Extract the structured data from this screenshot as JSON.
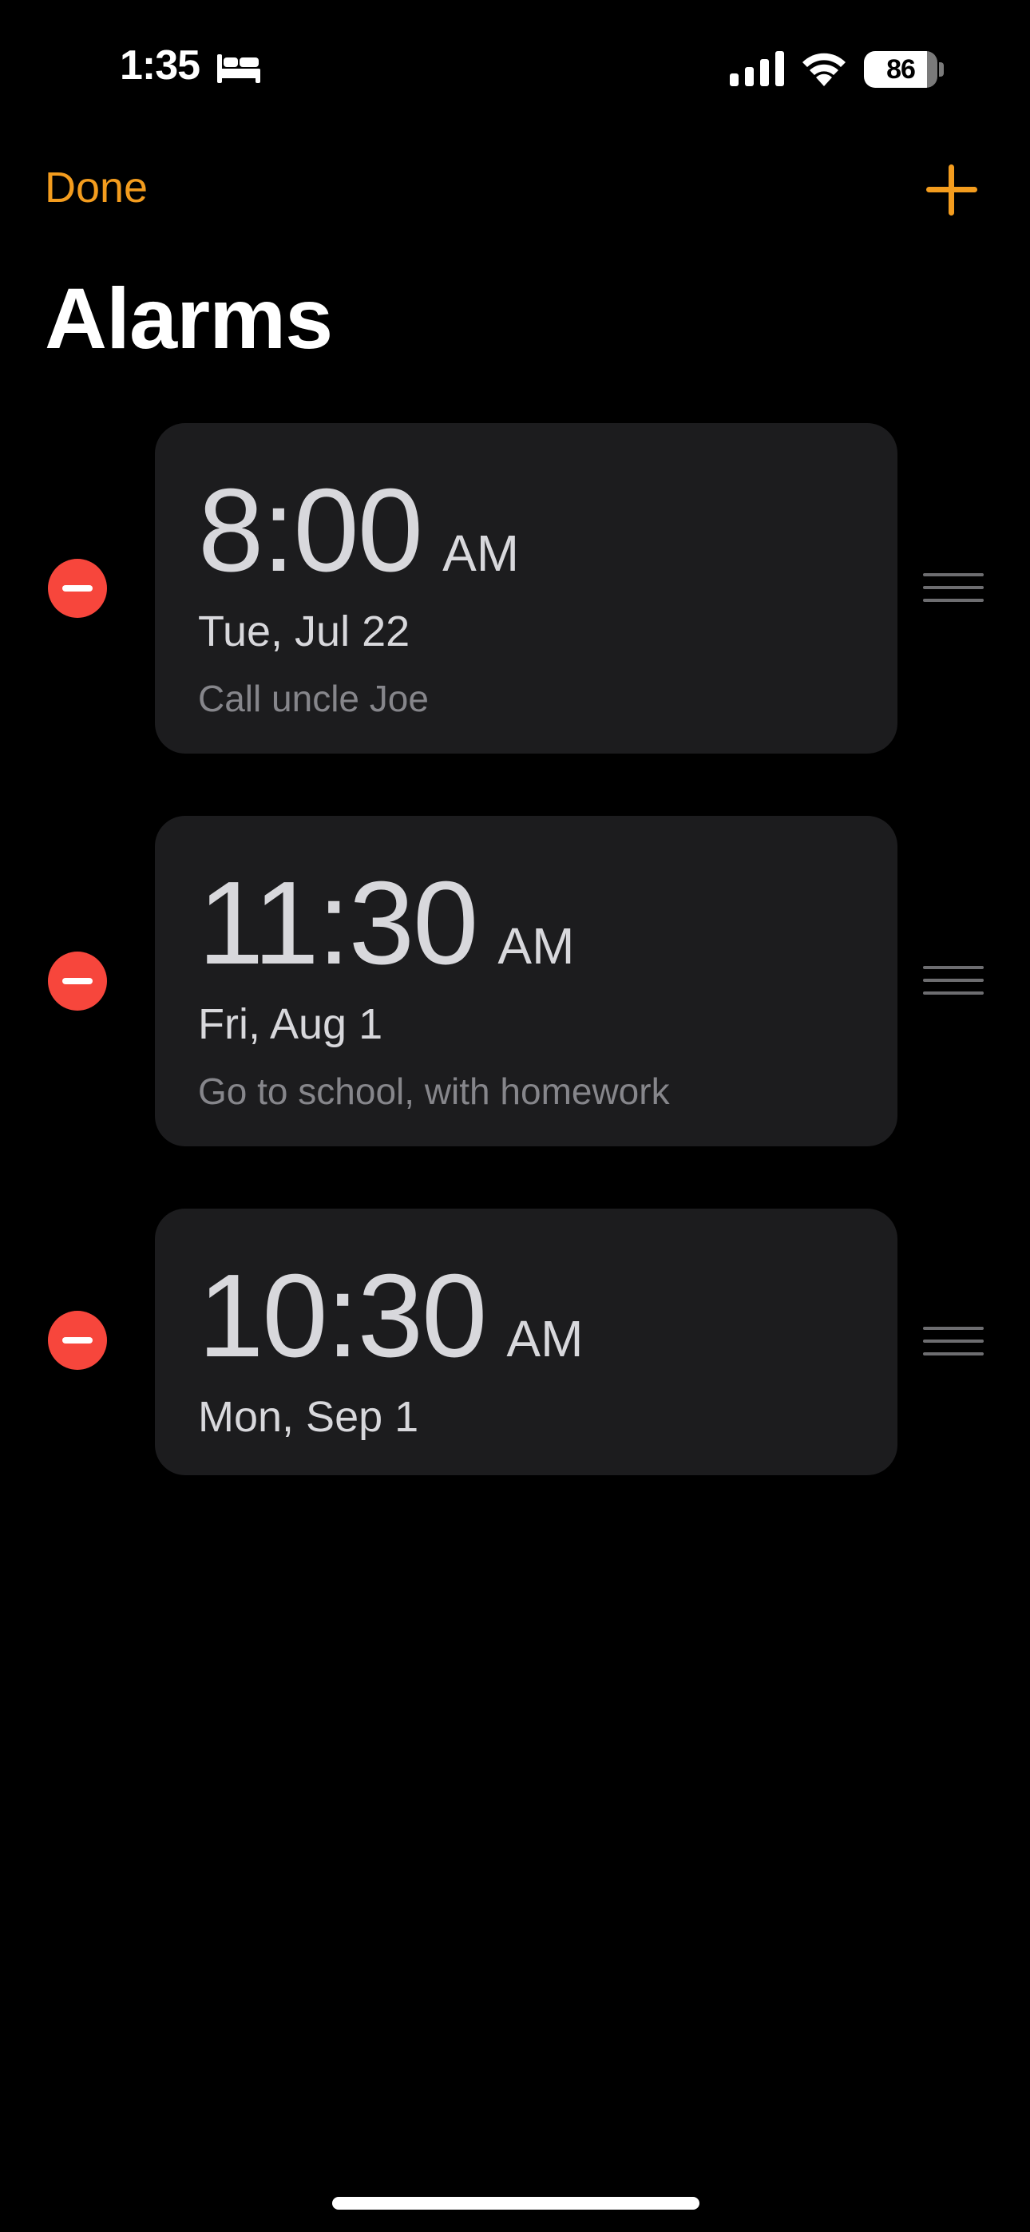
{
  "status_bar": {
    "time": "1:35",
    "battery": "86",
    "focus_icon": "bed-icon",
    "signal_icon": "cellular-signal-icon",
    "wifi_icon": "wifi-icon"
  },
  "nav": {
    "done_label": "Done",
    "add_icon": "plus-icon"
  },
  "title": "Alarms",
  "alarms": [
    {
      "time": "8:00",
      "ampm": "AM",
      "date": "Tue, Jul 22",
      "label": "Call uncle Joe"
    },
    {
      "time": "11:30",
      "ampm": "AM",
      "date": "Fri, Aug 1",
      "label": "Go to school, with homework"
    },
    {
      "time": "10:30",
      "ampm": "AM",
      "date": "Mon, Sep 1",
      "label": ""
    }
  ],
  "colors": {
    "background": "#000000",
    "accent": "#f39c1e",
    "delete": "#f7463c",
    "card": "#1c1c1e",
    "secondary_text": "#86868b"
  }
}
